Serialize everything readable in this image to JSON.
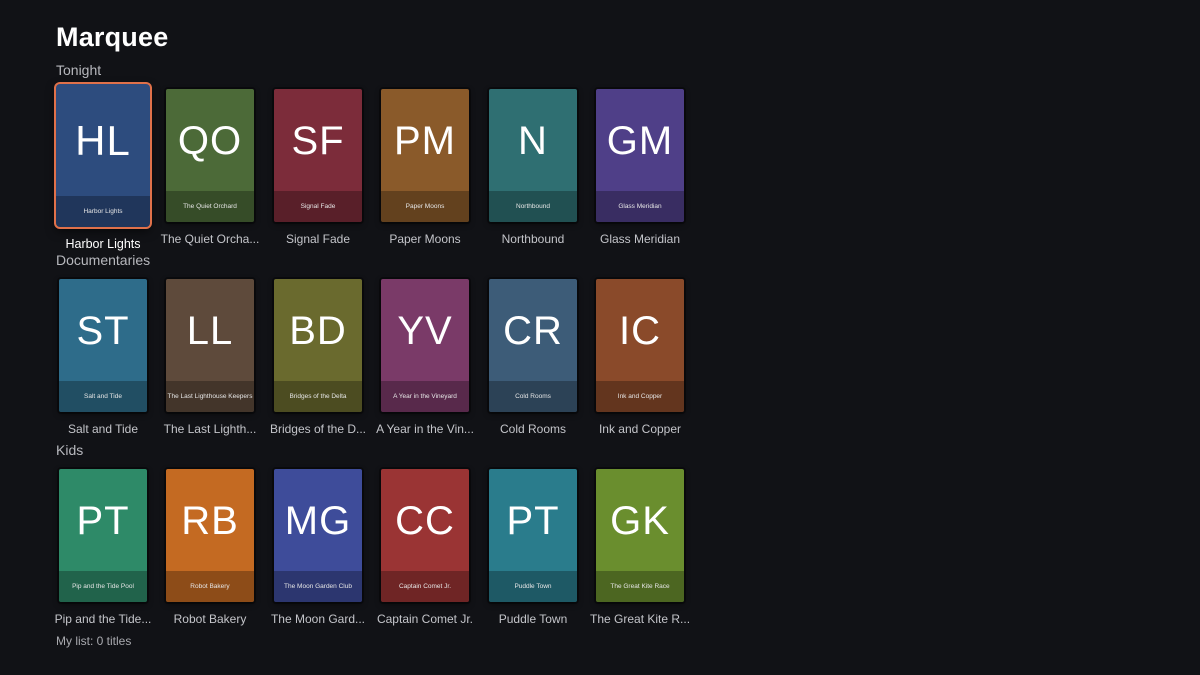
{
  "app": {
    "title": "Marquee"
  },
  "colors": {
    "focus_ring": "#e0714a",
    "background": "#111216"
  },
  "sections": [
    {
      "label": "Tonight",
      "items": [
        {
          "initials": "HL",
          "title": "Harbor Lights",
          "band": "Harbor Lights",
          "color": "#2d4c7e",
          "focused": true
        },
        {
          "initials": "QO",
          "title": "The Quiet Orcha...",
          "band": "The Quiet Orchard",
          "color": "#4c6a38"
        },
        {
          "initials": "SF",
          "title": "Signal Fade",
          "band": "Signal Fade",
          "color": "#7c2c3a"
        },
        {
          "initials": "PM",
          "title": "Paper Moons",
          "band": "Paper Moons",
          "color": "#8a5a2a"
        },
        {
          "initials": "N",
          "title": "Northbound",
          "band": "Northbound",
          "color": "#2f6f72"
        },
        {
          "initials": "GM",
          "title": "Glass Meridian",
          "band": "Glass Meridian",
          "color": "#4f3f88"
        }
      ]
    },
    {
      "label": "Documentaries",
      "items": [
        {
          "initials": "ST",
          "title": "Salt and Tide",
          "band": "Salt and Tide",
          "color": "#2e6c8a"
        },
        {
          "initials": "LL",
          "title": "The Last Lighth...",
          "band": "The Last Lighthouse Keepers",
          "color": "#5e4a3b"
        },
        {
          "initials": "BD",
          "title": "Bridges of the D...",
          "band": "Bridges of the Delta",
          "color": "#6a6a2e"
        },
        {
          "initials": "YV",
          "title": "A Year in the Vin...",
          "band": "A Year in the Vineyard",
          "color": "#7a3a68"
        },
        {
          "initials": "CR",
          "title": "Cold Rooms",
          "band": "Cold Rooms",
          "color": "#3d5c78"
        },
        {
          "initials": "IC",
          "title": "Ink and Copper",
          "band": "Ink and Copper",
          "color": "#8a4a2a"
        }
      ]
    },
    {
      "label": "Kids",
      "items": [
        {
          "initials": "PT",
          "title": "Pip and the Tide...",
          "band": "Pip and the Tide Pool",
          "color": "#2e8a68"
        },
        {
          "initials": "RB",
          "title": "Robot Bakery",
          "band": "Robot Bakery",
          "color": "#c46a22"
        },
        {
          "initials": "MG",
          "title": "The Moon Gard...",
          "band": "The Moon Garden Club",
          "color": "#3e4c9a"
        },
        {
          "initials": "CC",
          "title": "Captain Comet Jr.",
          "band": "Captain Comet Jr.",
          "color": "#9a3434"
        },
        {
          "initials": "PT",
          "title": "Puddle Town",
          "band": "Puddle Town",
          "color": "#2a7c8c"
        },
        {
          "initials": "GK",
          "title": "The Great Kite R...",
          "band": "The Great Kite Race",
          "color": "#6a8e2e"
        }
      ]
    }
  ],
  "footer": {
    "my_list": "My list: 0 titles"
  }
}
